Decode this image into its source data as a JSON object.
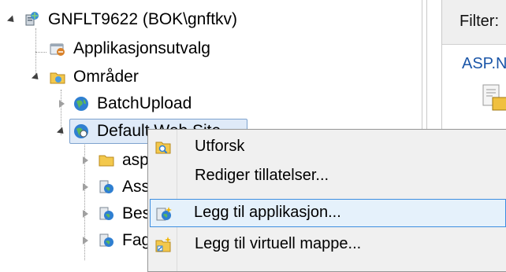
{
  "tree": {
    "server": {
      "label": "GNFLT9622 (BOK\\gnftkv)",
      "icon": "server-icon"
    },
    "app_pools": {
      "label": "Applikasjonsutvalg",
      "icon": "app-pools-icon"
    },
    "sites": {
      "label": "Områder",
      "icon": "sites-folder-icon"
    },
    "site_items": [
      {
        "label": "BatchUpload",
        "icon": "globe-icon"
      },
      {
        "label": "Default Web Site",
        "icon": "globe-icon"
      }
    ],
    "children": [
      {
        "label": "asp",
        "icon": "folder-icon"
      },
      {
        "label": "Ass",
        "icon": "web-app-icon"
      },
      {
        "label": "Bes",
        "icon": "web-app-icon"
      },
      {
        "label": "Fag",
        "icon": "web-app-icon"
      }
    ]
  },
  "right_pane": {
    "filter_label": "Filter:",
    "first_item": "ASP.N"
  },
  "context_menu": {
    "items": [
      {
        "label": "Utforsk",
        "icon": "explore-folder-icon",
        "highlighted": false
      },
      {
        "label": "Rediger tillatelser...",
        "icon": "",
        "highlighted": false
      },
      {
        "label": "Legg til applikasjon...",
        "icon": "add-application-icon",
        "highlighted": true
      },
      {
        "label": "Legg til virtuell mappe...",
        "icon": "add-virtual-directory-icon",
        "highlighted": false
      }
    ]
  },
  "colors": {
    "selection_bg": "#dfeaf8",
    "menu_highlight": "#e5f1fb",
    "link_blue": "#1b56a8"
  }
}
